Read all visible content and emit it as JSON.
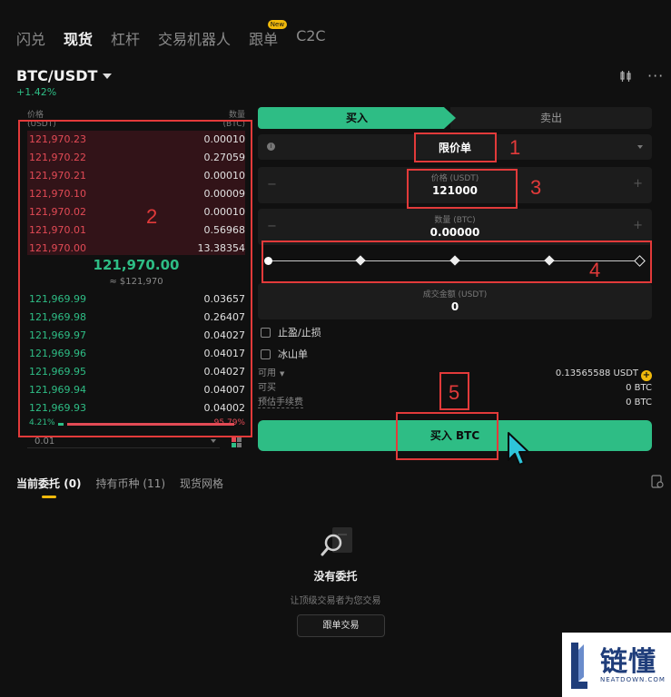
{
  "top_tabs": [
    {
      "label": "闪兑",
      "active": false
    },
    {
      "label": "现货",
      "active": true
    },
    {
      "label": "杠杆",
      "active": false
    },
    {
      "label": "交易机器人",
      "active": false
    },
    {
      "label": "跟单",
      "active": false,
      "badge": "New"
    },
    {
      "label": "C2C",
      "active": false
    }
  ],
  "pair": {
    "symbol": "BTC/USDT",
    "change": "+1.42%"
  },
  "orderbook": {
    "price_header": "价格",
    "price_unit": "(USDT)",
    "qty_header": "数量",
    "qty_unit": "(BTC)",
    "asks": [
      {
        "price": "121,970.23",
        "qty": "0.00010"
      },
      {
        "price": "121,970.22",
        "qty": "0.27059"
      },
      {
        "price": "121,970.21",
        "qty": "0.00010"
      },
      {
        "price": "121,970.10",
        "qty": "0.00009"
      },
      {
        "price": "121,970.02",
        "qty": "0.00010"
      },
      {
        "price": "121,970.01",
        "qty": "0.56968"
      },
      {
        "price": "121,970.00",
        "qty": "13.38354"
      }
    ],
    "mid_price": "121,970.00",
    "mid_usd": "≈ $121,970",
    "bids": [
      {
        "price": "121,969.99",
        "qty": "0.03657"
      },
      {
        "price": "121,969.98",
        "qty": "0.26407"
      },
      {
        "price": "121,969.97",
        "qty": "0.04027"
      },
      {
        "price": "121,969.96",
        "qty": "0.04017"
      },
      {
        "price": "121,969.95",
        "qty": "0.04027"
      },
      {
        "price": "121,969.94",
        "qty": "0.04007"
      },
      {
        "price": "121,969.93",
        "qty": "0.04002"
      }
    ],
    "buy_ratio": "4.21%",
    "sell_ratio": "95.79%",
    "depth": "0.01"
  },
  "form": {
    "buy_tab": "买入",
    "sell_tab": "卖出",
    "order_type": "限价单",
    "price_label": "价格 (USDT)",
    "price_value": "121000",
    "qty_label": "数量 (BTC)",
    "qty_value": "0.00000",
    "total_label": "成交金额 (USDT)",
    "total_value": "0",
    "tp_sl": "止盈/止损",
    "iceberg": "冰山单",
    "available_label": "可用",
    "available_value": "0.13565588 USDT",
    "can_buy_label": "可买",
    "can_buy_value": "0 BTC",
    "fee_label": "预估手续费",
    "fee_value": "0 BTC",
    "buy_button": "买入 BTC",
    "slider_percent": 0
  },
  "annotations": [
    "1",
    "2",
    "3",
    "4",
    "5"
  ],
  "bottom": {
    "tabs": [
      {
        "label": "当前委托",
        "count": "(0)",
        "active": true
      },
      {
        "label": "持有币种",
        "count": "(11)",
        "active": false
      },
      {
        "label": "现货网格",
        "count": "",
        "active": false
      }
    ],
    "empty_title": "没有委托",
    "empty_sub": "让顶级交易者为您交易",
    "follow_button": "跟单交易"
  },
  "watermark": {
    "text": "链懂",
    "sub": "NEATDOWN.COM"
  },
  "colors": {
    "green": "#2ebd85",
    "red": "#e24a55",
    "annotation": "#e23a3a",
    "accent": "#f0b90b"
  }
}
